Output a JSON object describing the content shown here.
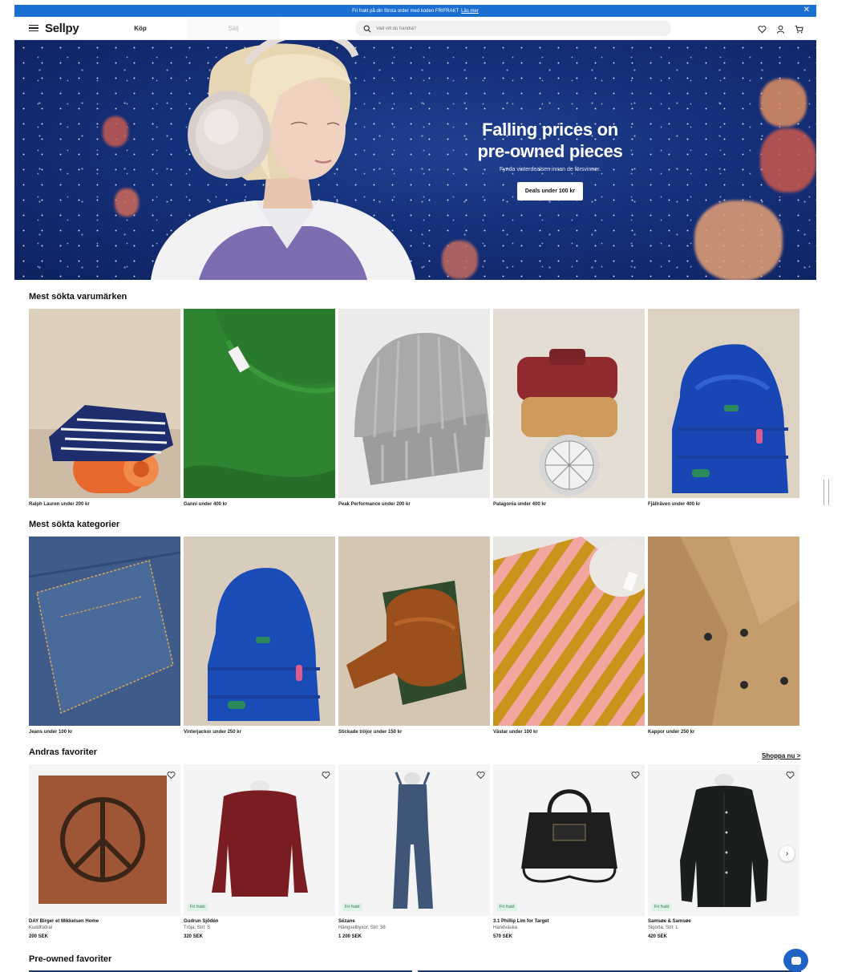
{
  "promo": {
    "text": "Fri frakt på din första order med koden FRIFRAKT",
    "link": "Läs mer",
    "close": "✕"
  },
  "header": {
    "logo": "Sellpy",
    "tabs": [
      "Köp",
      "Sälj"
    ],
    "search_placeholder": "Vad vill du handla?"
  },
  "hero": {
    "title_line1": "Falling prices on",
    "title_line2": "pre-owned pieces",
    "subtitle": "Fynda vinterdealsen innan de försvinner.",
    "button": "Deals under 100 kr"
  },
  "brands": {
    "title": "Mest sökta varumärken",
    "items": [
      {
        "caption": "Ralph Lauren under 200 kr"
      },
      {
        "caption": "Ganni under 400 kr"
      },
      {
        "caption": "Peak Performance under 200 kr"
      },
      {
        "caption": "Patagonia under 400 kr"
      },
      {
        "caption": "Fjällräven under 400 kr"
      }
    ]
  },
  "categories": {
    "title": "Mest sökta kategorier",
    "items": [
      {
        "caption": "Jeans under 100 kr"
      },
      {
        "caption": "Vinterjackor under 250 kr"
      },
      {
        "caption": "Stickade tröjor under 150 kr"
      },
      {
        "caption": "Västar under 100 kr"
      },
      {
        "caption": "Kappor under 250 kr"
      }
    ]
  },
  "favorites": {
    "title": "Andras favoriter",
    "shop_link": "Shoppa nu >",
    "items": [
      {
        "brand": "DAY Birger et Mikkelsen Home",
        "desc": "Kuddfodral",
        "price": "200 SEK",
        "badge": ""
      },
      {
        "brand": "Gudrun Sjödén",
        "desc": "Tröja, Strl: S",
        "price": "320 SEK",
        "badge": "Fri frakt"
      },
      {
        "brand": "Sézane",
        "desc": "Hängselbyxor, Strl: 38",
        "price": "1 200 SEK",
        "badge": "Fri frakt"
      },
      {
        "brand": "3.1 Phillip Lim for Target",
        "desc": "Handväska",
        "price": "570 SEK",
        "badge": "Fri frakt"
      },
      {
        "brand": "Samsøe & Samsøe",
        "desc": "Skjorta, Strl: L",
        "price": "420 SEK",
        "badge": "Fri frakt"
      }
    ]
  },
  "preowned": {
    "title": "Pre-owned favoriter"
  },
  "colors": {
    "promo": "#1a6fd1",
    "hero_bg": "#15307a",
    "badge_bg": "#dcf3e6",
    "chat": "#1f63c6"
  }
}
